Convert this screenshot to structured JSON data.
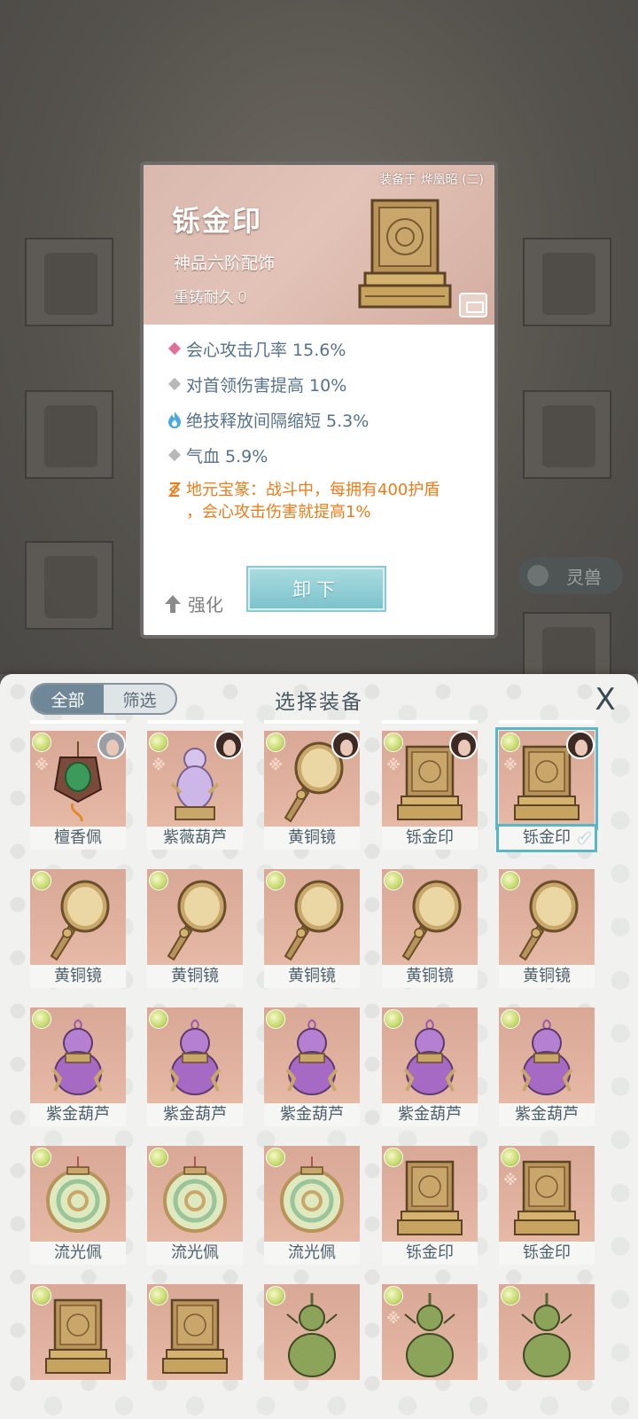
{
  "detail": {
    "equipped_on": "装备于 烨凰昭 (二)",
    "name": "铄金印",
    "grade": "神品六阶配饰",
    "durability_label": "重铸耐久",
    "durability_value": "0",
    "stats": [
      {
        "text": "会心攻击几率 15.6%",
        "marker": "pink-diamond"
      },
      {
        "text": "对首领伤害提高 10%",
        "marker": "gray-diamond"
      },
      {
        "text": "绝技释放间隔缩短 5.3%",
        "marker": "blue-flame"
      },
      {
        "text": "气血 5.9%",
        "marker": "gray-diamond"
      }
    ],
    "special_line1": "地元宝篆：战斗中，每拥有400护盾",
    "special_line2": "，会心攻击伤害就提高1%",
    "upgrade_label": "强化",
    "unequip_label": "卸下"
  },
  "background": {
    "pill_label": "灵兽"
  },
  "panel": {
    "filter_all": "全部",
    "filter_select": "筛选",
    "title": "选择装备",
    "close_label": "X"
  },
  "items": [
    {
      "name": "檀香佩",
      "art": "pendant-green",
      "avatar": "pale",
      "set_mark": true
    },
    {
      "name": "紫薇葫芦",
      "art": "gourd-purple-light",
      "avatar": "dark",
      "set_mark": true
    },
    {
      "name": "黄铜镜",
      "art": "mirror",
      "avatar": "dark",
      "set_mark": true
    },
    {
      "name": "铄金印",
      "art": "seal",
      "avatar": "dark",
      "set_mark": true
    },
    {
      "name": "铄金印",
      "art": "seal",
      "avatar": "dark",
      "set_mark": true,
      "selected": true
    },
    {
      "name": "黄铜镜",
      "art": "mirror"
    },
    {
      "name": "黄铜镜",
      "art": "mirror"
    },
    {
      "name": "黄铜镜",
      "art": "mirror"
    },
    {
      "name": "黄铜镜",
      "art": "mirror"
    },
    {
      "name": "黄铜镜",
      "art": "mirror"
    },
    {
      "name": "紫金葫芦",
      "art": "gourd-purple"
    },
    {
      "name": "紫金葫芦",
      "art": "gourd-purple"
    },
    {
      "name": "紫金葫芦",
      "art": "gourd-purple"
    },
    {
      "name": "紫金葫芦",
      "art": "gourd-purple"
    },
    {
      "name": "紫金葫芦",
      "art": "gourd-purple"
    },
    {
      "name": "流光佩",
      "art": "jade-disc"
    },
    {
      "name": "流光佩",
      "art": "jade-disc"
    },
    {
      "name": "流光佩",
      "art": "jade-disc"
    },
    {
      "name": "铄金印",
      "art": "seal"
    },
    {
      "name": "铄金印",
      "art": "seal",
      "set_mark": true
    },
    {
      "name": "",
      "art": "seal"
    },
    {
      "name": "",
      "art": "seal"
    },
    {
      "name": "",
      "art": "gourd-green"
    },
    {
      "name": "",
      "art": "gourd-green",
      "set_mark": true
    },
    {
      "name": "",
      "art": "gourd-green"
    }
  ],
  "colors": {
    "stat_text": "#56728b",
    "special_text": "#ef7b18",
    "card_bg": "#e6b8a6",
    "accent_teal": "#59b6c6"
  }
}
